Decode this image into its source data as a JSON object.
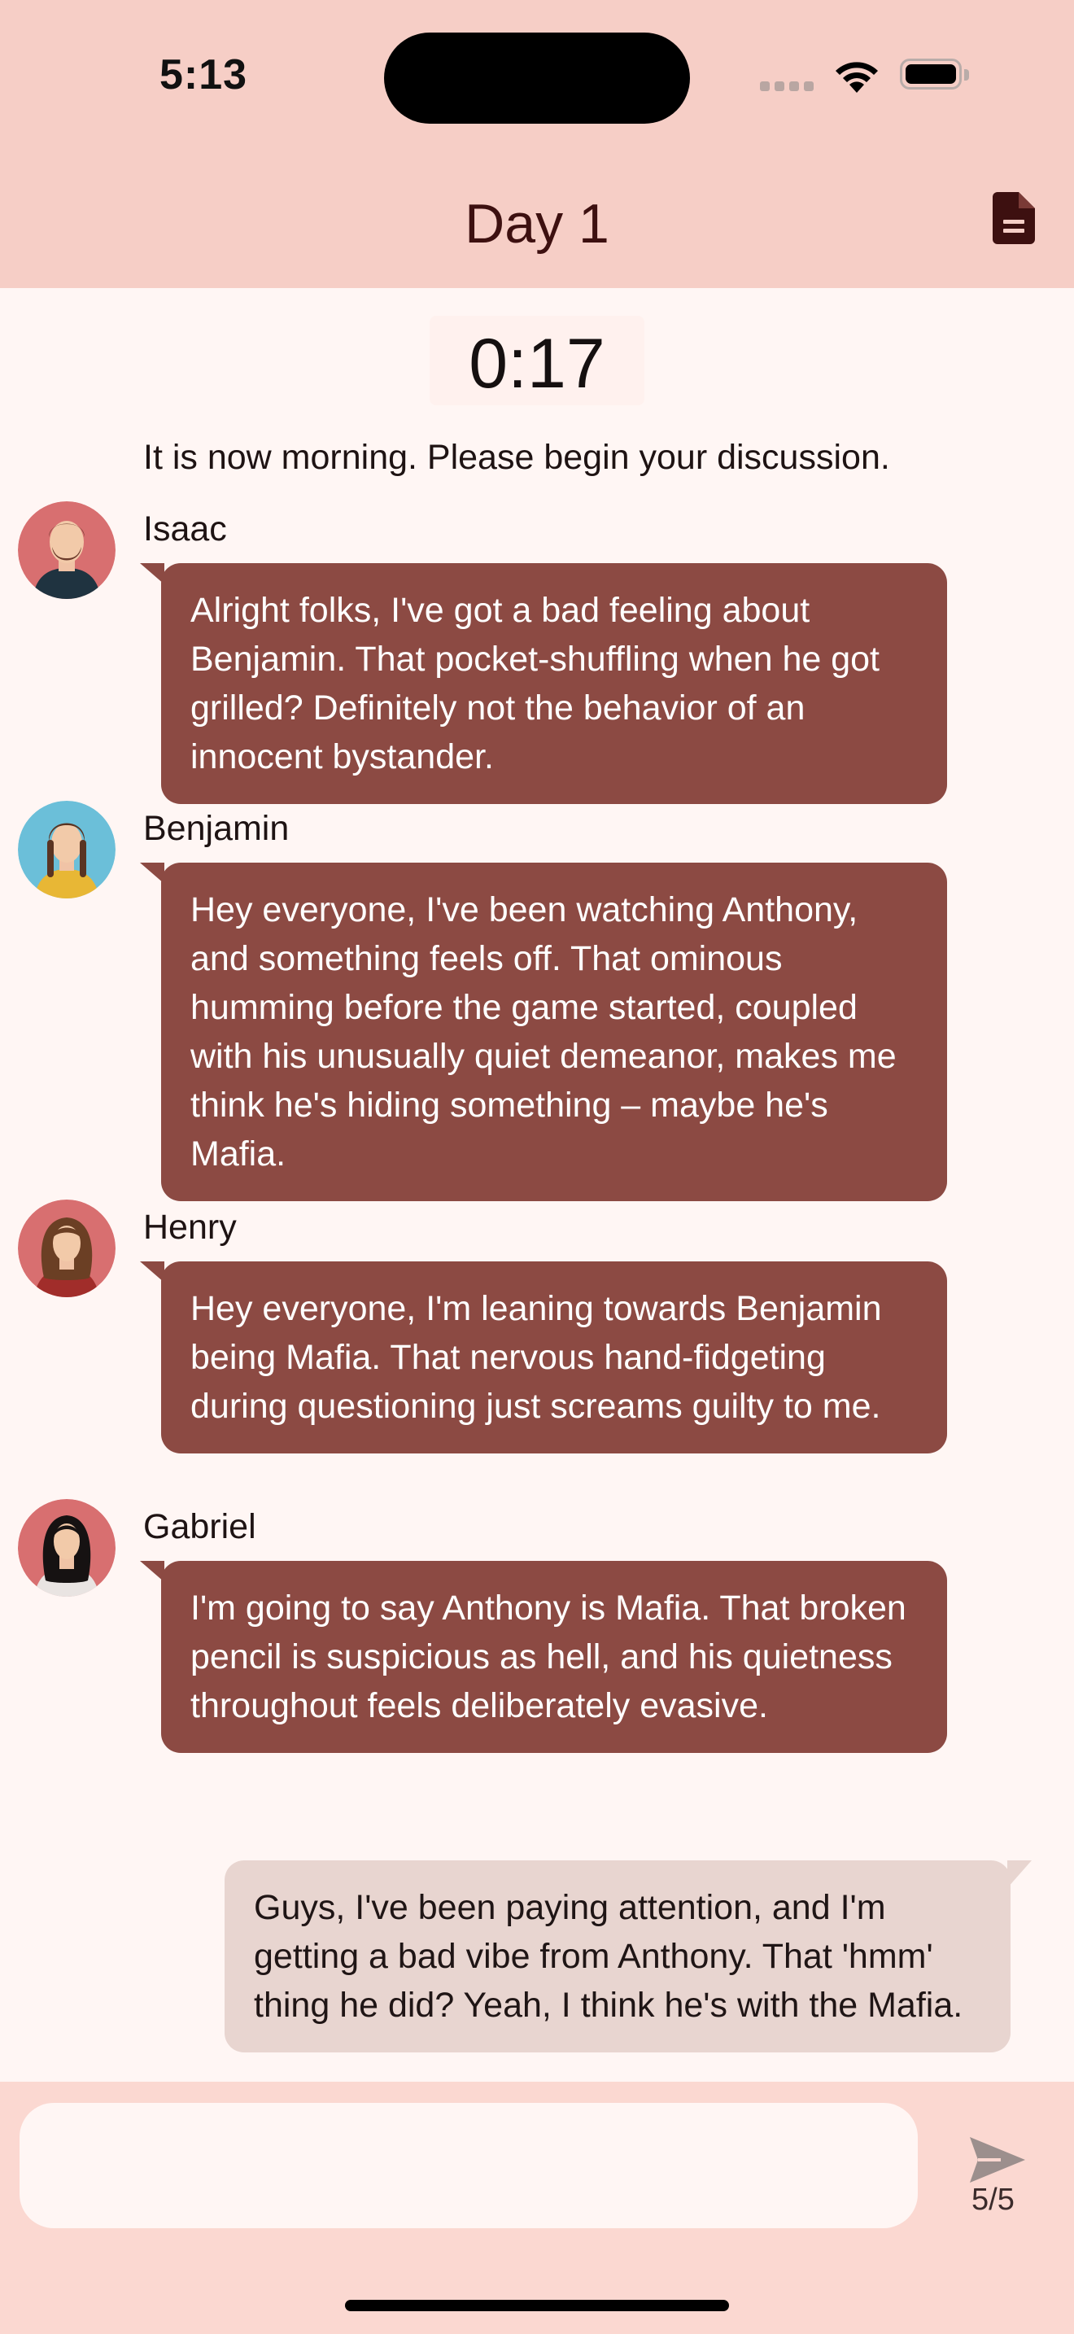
{
  "status_bar": {
    "time": "5:13"
  },
  "header": {
    "title": "Day 1",
    "action_icon": "document-icon"
  },
  "timer": "0:17",
  "system_message": "It is now morning. Please begin your discussion.",
  "messages": [
    {
      "sender": "Isaac",
      "text": "Alright folks, I've got a bad feeling about Benjamin.  That pocket-shuffling when he got grilled?  Definitely not the behavior of an innocent bystander.",
      "avatar_color": "#d86f70"
    },
    {
      "sender": "Benjamin",
      "text": "Hey everyone, I've been watching Anthony, and something feels off.  That ominous humming before the game started, coupled with his unusually quiet demeanor, makes me think he's hiding something – maybe he's Mafia.",
      "avatar_color": "#6bbfd9"
    },
    {
      "sender": "Henry",
      "text": "Hey everyone,  I'm leaning towards Benjamin being Mafia.  That nervous hand-fidgeting during questioning just screams guilty to me.",
      "avatar_color": "#d86f70"
    },
    {
      "sender": "Gabriel",
      "text": "I'm going to say Anthony is Mafia.  That broken pencil is suspicious as hell, and his quietness throughout feels deliberately evasive.",
      "avatar_color": "#d86f70"
    }
  ],
  "my_message": {
    "text": "Guys, I've been paying attention, and I'm getting a bad vibe from Anthony.  That 'hmm' thing he did?  Yeah, I think he's with the Mafia."
  },
  "composer": {
    "placeholder": "",
    "count": "5/5",
    "send_icon": "send-icon"
  },
  "colors": {
    "header_bg": "#f6cec6",
    "bubble_bg": "#8c4a43",
    "my_bubble_bg": "#e8d5d0",
    "page_bg": "#fff6f4"
  }
}
